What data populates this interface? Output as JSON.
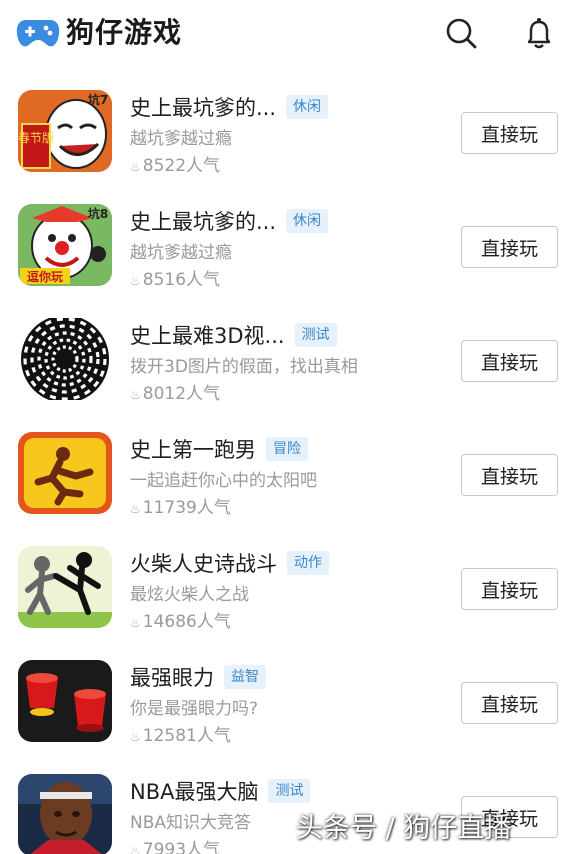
{
  "header": {
    "title": "狗仔游戏",
    "brand_color": "#3b8be0",
    "icons": [
      "gamepad-logo-icon",
      "search-icon",
      "bell-icon"
    ]
  },
  "games": [
    {
      "title": "史上最坑爹的...",
      "tag": "休闲",
      "desc": "越坑爹越过瘾",
      "popularity": "8522人气",
      "play": "直接玩",
      "icon": "troll-face-spring-icon"
    },
    {
      "title": "史上最坑爹的...",
      "tag": "休闲",
      "desc": "越坑爹越过瘾",
      "popularity": "8516人气",
      "play": "直接玩",
      "icon": "clown-face-icon"
    },
    {
      "title": "史上最难3D视...",
      "tag": "测试",
      "desc": "拨开3D图片的假面，找出真相",
      "popularity": "8012人气",
      "play": "直接玩",
      "icon": "optical-illusion-icon"
    },
    {
      "title": "史上第一跑男",
      "tag": "冒险",
      "desc": "一起追赶你心中的太阳吧",
      "popularity": "11739人气",
      "play": "直接玩",
      "icon": "running-man-icon"
    },
    {
      "title": "火柴人史诗战斗",
      "tag": "动作",
      "desc": "最炫火柴人之战",
      "popularity": "14686人气",
      "play": "直接玩",
      "icon": "stickman-fight-icon"
    },
    {
      "title": "最强眼力",
      "tag": "益智",
      "desc": "你是最强眼力吗?",
      "popularity": "12581人气",
      "play": "直接玩",
      "icon": "cups-icon"
    },
    {
      "title": "NBA最强大脑",
      "tag": "测试",
      "desc": "NBA知识大竞答",
      "popularity": "7993人气",
      "play": "直接玩",
      "icon": "basketball-player-icon"
    }
  ],
  "icon_text": {
    "spring_badge": "春节版",
    "level_badge_1": "坑7",
    "level_badge_2": "坑8",
    "tease_badge": "逗你玩"
  },
  "watermark": "头条号 / 狗仔直播",
  "fire_glyph": "🔥"
}
